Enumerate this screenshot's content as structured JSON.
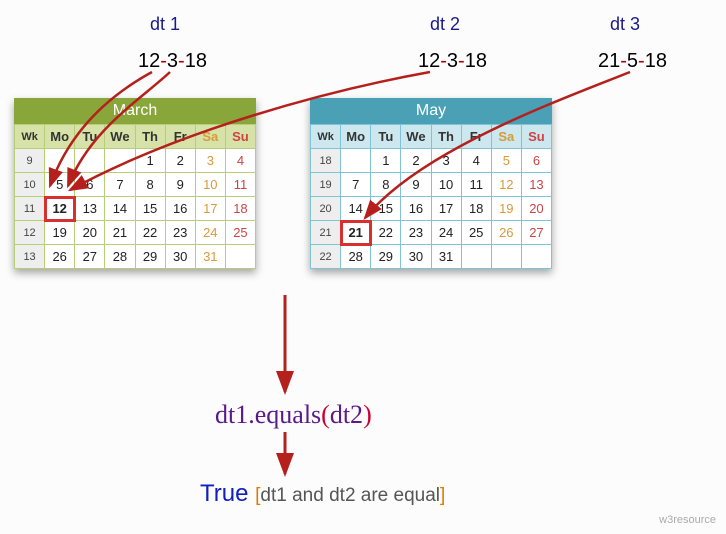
{
  "labels": {
    "dt1": "dt 1",
    "dt2": "dt 2",
    "dt3": "dt 3"
  },
  "dates": {
    "dt1": "12-3-18",
    "dt2": "12-3-18",
    "dt3": "21-5-18"
  },
  "calendars": {
    "march": {
      "title": "March",
      "headers": [
        "Wk",
        "Mo",
        "Tu",
        "We",
        "Th",
        "Fr",
        "Sa",
        "Su"
      ],
      "weeks": [
        {
          "wk": 9,
          "days": [
            "",
            "",
            "",
            1,
            2,
            3,
            4
          ]
        },
        {
          "wk": 10,
          "days": [
            5,
            6,
            7,
            8,
            9,
            10,
            11
          ]
        },
        {
          "wk": 11,
          "days": [
            12,
            13,
            14,
            15,
            16,
            17,
            18
          ]
        },
        {
          "wk": 12,
          "days": [
            19,
            20,
            21,
            22,
            23,
            24,
            25
          ]
        },
        {
          "wk": 13,
          "days": [
            26,
            27,
            28,
            29,
            30,
            31,
            ""
          ]
        }
      ],
      "highlight": 12
    },
    "may": {
      "title": "May",
      "headers": [
        "Wk",
        "Mo",
        "Tu",
        "We",
        "Th",
        "Fr",
        "Sa",
        "Su"
      ],
      "weeks": [
        {
          "wk": 18,
          "days": [
            "",
            1,
            2,
            3,
            4,
            5,
            6
          ]
        },
        {
          "wk": 19,
          "days": [
            7,
            8,
            9,
            10,
            11,
            12,
            13
          ]
        },
        {
          "wk": 20,
          "days": [
            14,
            15,
            16,
            17,
            18,
            19,
            20
          ]
        },
        {
          "wk": 21,
          "days": [
            21,
            22,
            23,
            24,
            25,
            26,
            27
          ]
        },
        {
          "wk": 22,
          "days": [
            28,
            29,
            30,
            31,
            "",
            "",
            ""
          ]
        }
      ],
      "highlight": 21
    }
  },
  "expression": {
    "obj": "dt1",
    "method": ".equals",
    "open": "(",
    "arg": "dt2",
    "close": ")"
  },
  "result": {
    "value": "True",
    "note_open": "[",
    "note": "dt1 and dt2 are equal",
    "note_close": "]"
  },
  "watermark": "w3resource"
}
